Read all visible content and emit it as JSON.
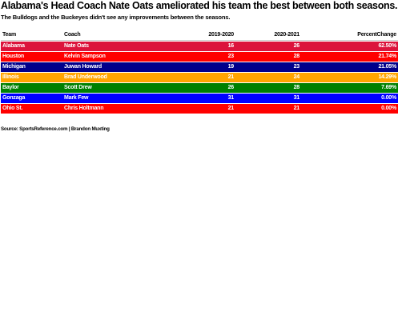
{
  "title": "Alabama's Head Coach Nate Oats ameliorated his team the best between both seasons.",
  "subtitle": "The Bulldogs and the Buckeyes didn't see any improvements between the seasons.",
  "source": "Source: SportsReference.com | Brandon Muxting",
  "chart_data": {
    "type": "table",
    "title": "Alabama's Head Coach Nate Oats ameliorated his team the best between both seasons.",
    "subtitle": "The Bulldogs and the Buckeyes didn't see any improvements between the seasons.",
    "columns": [
      "Team",
      "Coach",
      "2019-2020",
      "2020-2021",
      "PercentChange"
    ],
    "rows": [
      {
        "team": "Alabama",
        "coach": "Nate Oats",
        "y2019_2020": "16",
        "y2020_2021": "26",
        "pct_change": "62.50%",
        "color": "#dc143c"
      },
      {
        "team": "Houston",
        "coach": "Kelvin Sampson",
        "y2019_2020": "23",
        "y2020_2021": "28",
        "pct_change": "21.74%",
        "color": "#ff0000"
      },
      {
        "team": "Michigan",
        "coach": "Juwan Howard",
        "y2019_2020": "19",
        "y2020_2021": "23",
        "pct_change": "21.05%",
        "color": "#00008b"
      },
      {
        "team": "Illinois",
        "coach": "Brad Underwood",
        "y2019_2020": "21",
        "y2020_2021": "24",
        "pct_change": "14.29%",
        "color": "#ffa500"
      },
      {
        "team": "Baylor",
        "coach": "Scott Drew",
        "y2019_2020": "26",
        "y2020_2021": "28",
        "pct_change": "7.69%",
        "color": "#008000"
      },
      {
        "team": "Gonzaga",
        "coach": "Mark Few",
        "y2019_2020": "31",
        "y2020_2021": "31",
        "pct_change": "0.00%",
        "color": "#0000ff"
      },
      {
        "team": "Ohio St.",
        "coach": "Chris Holtmann",
        "y2019_2020": "21",
        "y2020_2021": "21",
        "pct_change": "0.00%",
        "color": "#ff0000"
      }
    ],
    "source": "Source: SportsReference.com | Brandon Muxting"
  }
}
